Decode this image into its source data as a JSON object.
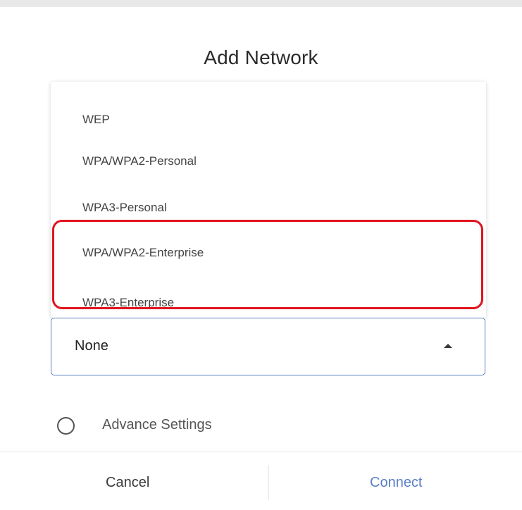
{
  "dialog": {
    "title": "Add Network"
  },
  "security_dropdown": {
    "options": [
      "WEP",
      "WPA/WPA2-Personal",
      "WPA3-Personal",
      "WPA/WPA2-Enterprise",
      "WPA3-Enterprise"
    ],
    "selected_value": "None",
    "highlight_color": "#e0141e",
    "border_color": "#5a7fc0"
  },
  "advance_settings": {
    "label": "Advance Settings"
  },
  "footer": {
    "cancel_label": "Cancel",
    "connect_label": "Connect",
    "connect_color": "#5b7fc4"
  }
}
